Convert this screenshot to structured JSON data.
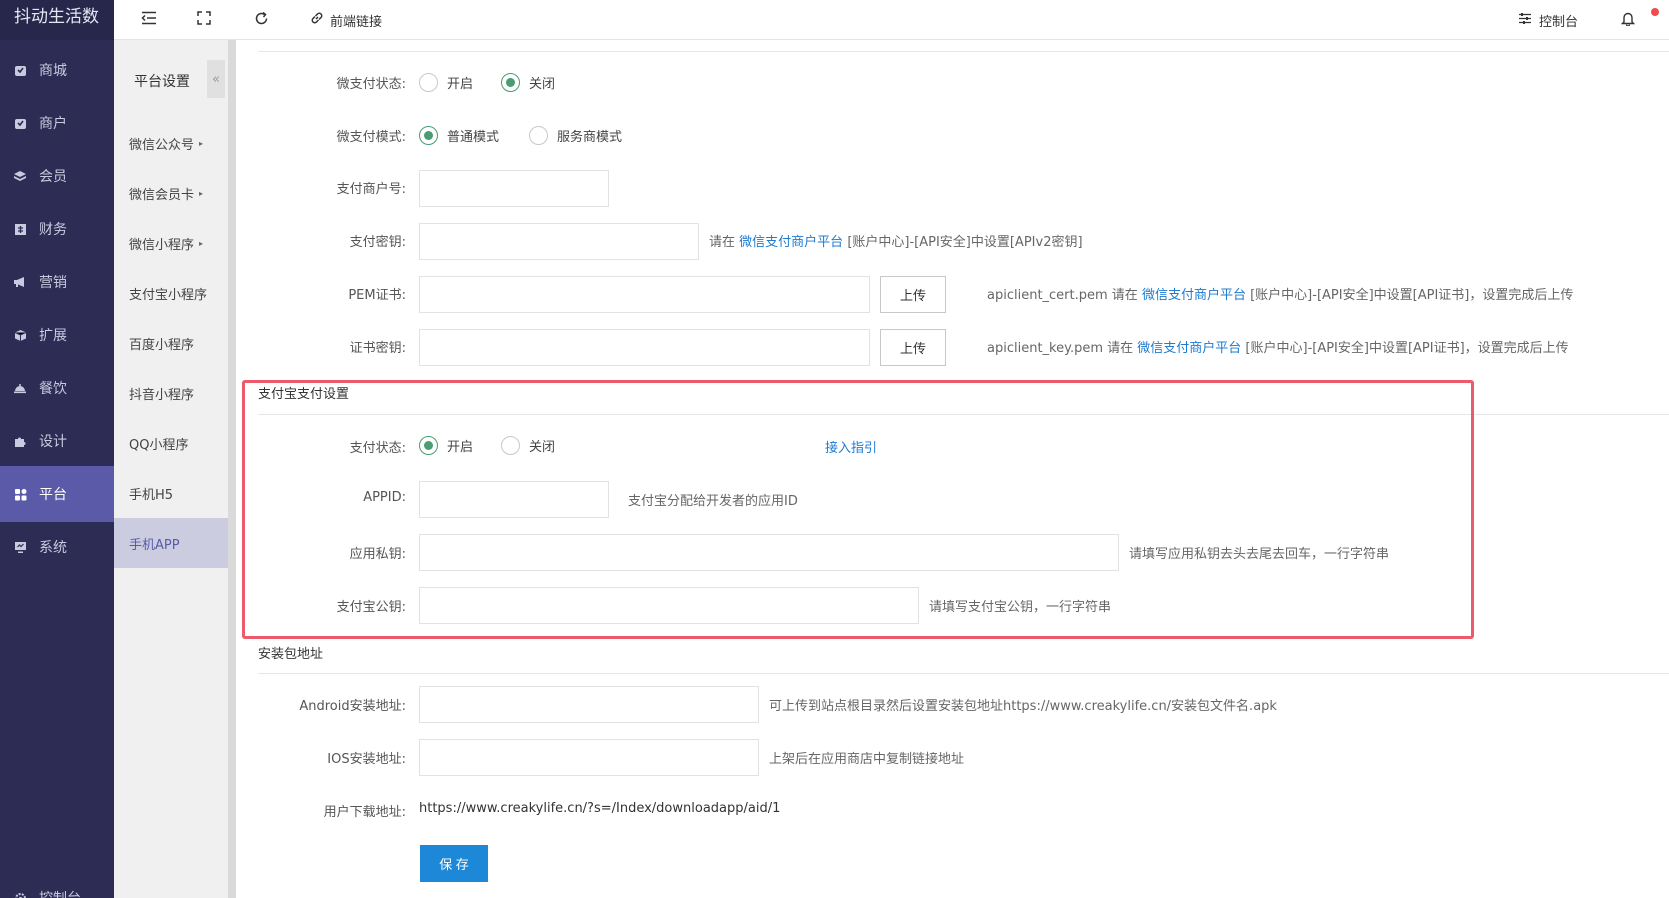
{
  "brand": "抖动生活数",
  "nav": [
    {
      "label": "商城",
      "icon": "shop-icon"
    },
    {
      "label": "商户",
      "icon": "merchant-icon"
    },
    {
      "label": "会员",
      "icon": "member-icon"
    },
    {
      "label": "财务",
      "icon": "finance-icon"
    },
    {
      "label": "营销",
      "icon": "megaphone-icon"
    },
    {
      "label": "扩展",
      "icon": "cube-icon"
    },
    {
      "label": "餐饮",
      "icon": "dining-icon"
    },
    {
      "label": "设计",
      "icon": "puzzle-icon"
    },
    {
      "label": "平台",
      "icon": "grid-icon",
      "active": true
    },
    {
      "label": "系统",
      "icon": "monitor-icon"
    },
    {
      "label": "控制台",
      "icon": "gear-icon"
    }
  ],
  "sub": {
    "title": "平台设置",
    "collapse": "«",
    "items": [
      {
        "label": "微信公众号",
        "arrow": "▸"
      },
      {
        "label": "微信会员卡",
        "arrow": "▸"
      },
      {
        "label": "微信小程序",
        "arrow": "▸"
      },
      {
        "label": "支付宝小程序"
      },
      {
        "label": "百度小程序"
      },
      {
        "label": "抖音小程序"
      },
      {
        "label": "QQ小程序"
      },
      {
        "label": "手机H5"
      },
      {
        "label": "手机APP",
        "active": true
      }
    ]
  },
  "topbar": {
    "frontend_link": "前端链接",
    "console": "控制台"
  },
  "wechat_pay": {
    "status_label": "微支付状态:",
    "status_on": "开启",
    "status_off": "关闭",
    "mode_label": "微支付模式:",
    "mode_normal": "普通模式",
    "mode_service": "服务商模式",
    "merchant_label": "支付商户号:",
    "key_label": "支付密钥:",
    "key_help_prefix": "请在",
    "key_help_link": "微信支付商户平台",
    "key_help_suffix": "[账户中心]-[API安全]中设置[APIv2密钥]",
    "pem_label": "PEM证书:",
    "upload": "上传",
    "pem_help_prefix": "apiclient_cert.pem 请在",
    "pem_help_link": "微信支付商户平台",
    "pem_help_suffix": "[账户中心]-[API安全]中设置[API证书]，设置完成后上传",
    "cert_key_label": "证书密钥:",
    "cert_key_help_prefix": "apiclient_key.pem 请在",
    "cert_key_help_link": "微信支付商户平台",
    "cert_key_help_suffix": "[账户中心]-[API安全]中设置[API证书]，设置完成后上传"
  },
  "alipay": {
    "section_title": "支付宝支付设置",
    "status_label": "支付状态:",
    "status_on": "开启",
    "status_off": "关闭",
    "guide_link": "接入指引",
    "appid_label": "APPID:",
    "appid_help": "支付宝分配给开发者的应用ID",
    "private_key_label": "应用私钥:",
    "private_key_help": "请填写应用私钥去头去尾去回车，一行字符串",
    "public_key_label": "支付宝公钥:",
    "public_key_help": "请填写支付宝公钥，一行字符串"
  },
  "install": {
    "section_title": "安装包地址",
    "android_label": "Android安装地址:",
    "android_help": "可上传到站点根目录然后设置安装包地址https://www.creakylife.cn/安装包文件名.apk",
    "ios_label": "IOS安装地址:",
    "ios_help": "上架后在应用商店中复制链接地址",
    "download_label": "用户下载地址:",
    "download_url": "https://www.creakylife.cn/?s=/Index/downloadapp/aid/1"
  },
  "save_label": "保 存",
  "colors": {
    "sidebar": "#2c2c54",
    "active_nav": "#5a5aa8",
    "radio_on": "#4a9c72",
    "link": "#1e7bd0",
    "highlight": "#ec5a6b",
    "save": "#1e88d8"
  }
}
